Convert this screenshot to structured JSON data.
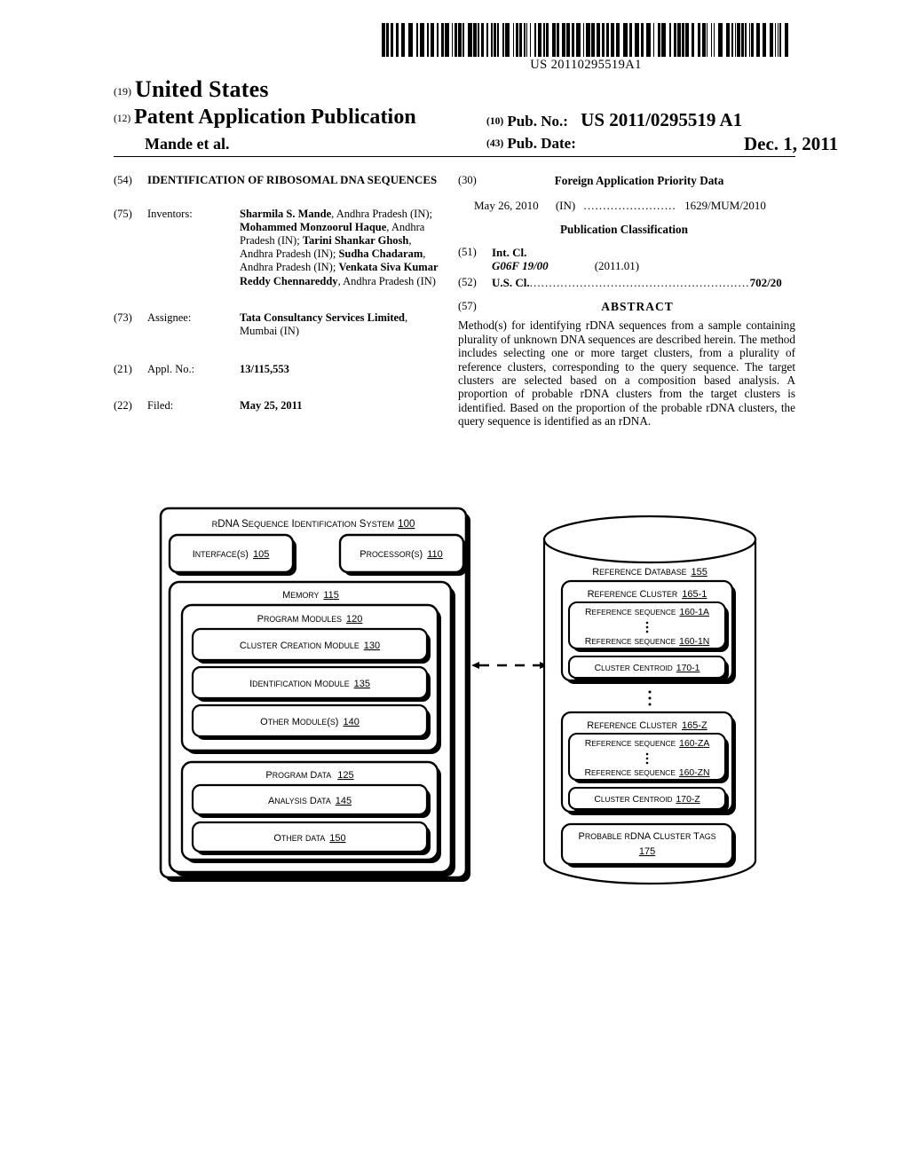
{
  "barcode": {
    "publication_number_text": "US 20110295519A1"
  },
  "header": {
    "code_19": "(19)",
    "country": "United States",
    "code_12": "(12)",
    "doc_type": "Patent Application Publication",
    "applicant_short": "Mande et al.",
    "code_10": "(10)",
    "pub_no_label": "Pub. No.:",
    "pub_no_value": "US 2011/0295519 A1",
    "code_43": "(43)",
    "pub_date_label": "Pub. Date:",
    "pub_date_value": "Dec. 1, 2011"
  },
  "left_column": {
    "title": {
      "code": "(54)",
      "text": "IDENTIFICATION OF RIBOSOMAL DNA SEQUENCES"
    },
    "inventors": {
      "code": "(75)",
      "label": "Inventors:",
      "list": [
        {
          "name": "Sharmila S. Mande",
          "location": ", Andhra Pradesh (IN); "
        },
        {
          "name": "Mohammed Monzoorul Haque",
          "location": ", Andhra Pradesh (IN); "
        },
        {
          "name": "Tarini Shankar Ghosh",
          "location": ", Andhra Pradesh (IN); "
        },
        {
          "name": "Sudha Chadaram",
          "location": ", Andhra Pradesh (IN); "
        },
        {
          "name": "Venkata Siva Kumar Reddy Chennareddy",
          "location": ", Andhra Pradesh (IN)"
        }
      ]
    },
    "assignee": {
      "code": "(73)",
      "label": "Assignee:",
      "name": "Tata Consultancy Services Limited",
      "location": ", Mumbai (IN)"
    },
    "appl_no": {
      "code": "(21)",
      "label": "Appl. No.:",
      "value": "13/115,553"
    },
    "filed": {
      "code": "(22)",
      "label": "Filed:",
      "value": "May 25, 2011"
    }
  },
  "right_column": {
    "foreign_priority": {
      "code": "(30)",
      "heading": "Foreign Application Priority Data",
      "date": "May 26, 2010",
      "country": "(IN)",
      "dots": "........................",
      "number": "1629/MUM/2010"
    },
    "publication_classification_heading": "Publication Classification",
    "int_cl": {
      "code": "(51)",
      "label": "Int. Cl.",
      "symbol": "G06F  19/00",
      "version": "(2011.01)"
    },
    "us_cl": {
      "code": "(52)",
      "label": "U.S. Cl.",
      "dots": ".........................................................",
      "value": "702/20"
    },
    "abstract": {
      "code": "(57)",
      "heading": "ABSTRACT",
      "text": "Method(s) for identifying rDNA sequences from a sample containing plurality of unknown DNA sequences are described herein. The method includes selecting one or more target clusters, from a plurality of reference clusters, corresponding to the query sequence. The target clusters are selected based on a composition based analysis. A proportion of probable rDNA clusters from the target clusters is identified. Based on the proportion of the probable rDNA clusters, the query sequence is identified as an rDNA."
    }
  },
  "diagram": {
    "system": {
      "title_text": "rDNA Sequence Identification System",
      "title_ref": "100",
      "interfaces": {
        "text": "Interface(s)",
        "ref": "105"
      },
      "processors": {
        "text": "Processor(s)",
        "ref": "110"
      },
      "memory": {
        "text": "Memory",
        "ref": "115"
      },
      "program_modules": {
        "text": "Program Modules",
        "ref": "120"
      },
      "modules": [
        {
          "text": "Cluster Creation Module",
          "ref": "130"
        },
        {
          "text": "Identification Module",
          "ref": "135"
        },
        {
          "text": "Other Module(s)",
          "ref": "140"
        }
      ],
      "program_data": {
        "text": "Program Data",
        "ref": "125"
      },
      "data_items": [
        {
          "text": "Analysis Data",
          "ref": "145"
        },
        {
          "text": "Other data",
          "ref": "150"
        }
      ]
    },
    "database": {
      "title_text": "Reference Database",
      "title_ref": "155",
      "clusters": [
        {
          "title_text": "Reference Cluster",
          "title_ref": "165-1",
          "sequences": [
            {
              "text": "Reference sequence",
              "ref": "160-1A"
            },
            {
              "text": "Reference sequence",
              "ref": "160-1N"
            }
          ],
          "centroid": {
            "text": "Cluster Centroid",
            "ref": "170-1"
          }
        },
        {
          "title_text": "Reference Cluster",
          "title_ref": "165-Z",
          "sequences": [
            {
              "text": "Reference sequence",
              "ref": "160-ZA"
            },
            {
              "text": "Reference sequence",
              "ref": "160-ZN"
            }
          ],
          "centroid": {
            "text": "Cluster Centroid",
            "ref": "170-Z"
          }
        }
      ],
      "probable_tags": {
        "text": "Probable rDNA Cluster Tags",
        "ref": "175"
      }
    },
    "connector": "bidirectional-dashed-arrow"
  }
}
